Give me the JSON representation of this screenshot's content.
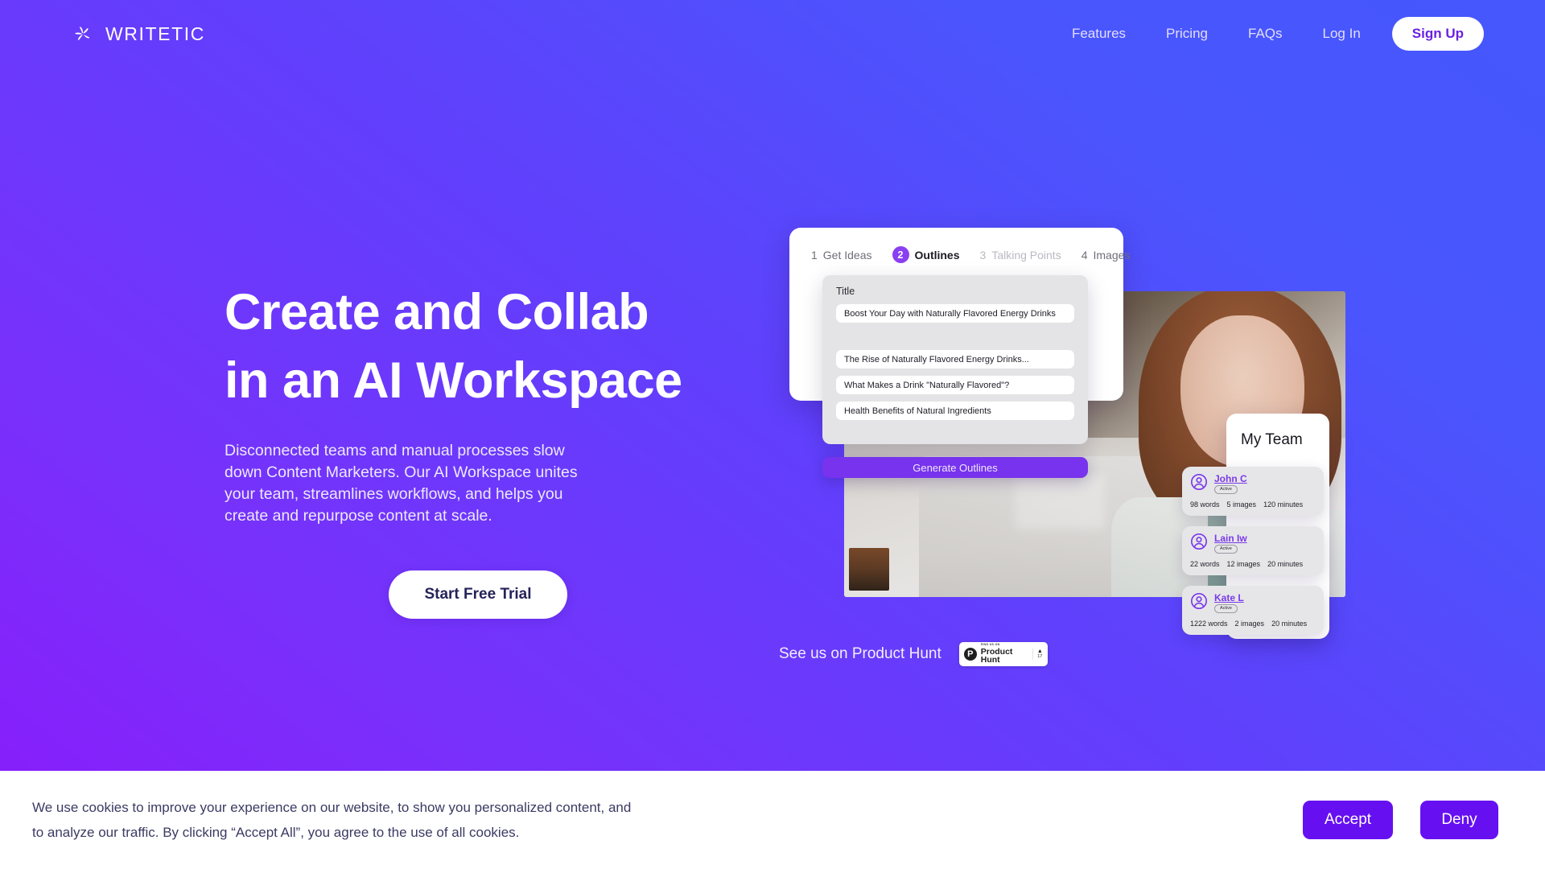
{
  "nav": {
    "brand": "WRITETIC",
    "logo_icon": "pinwheel-star-icon",
    "links": [
      {
        "label": "Features"
      },
      {
        "label": "Pricing"
      },
      {
        "label": "FAQs"
      },
      {
        "label": "Log In"
      }
    ],
    "cta": "Sign Up"
  },
  "hero": {
    "title_line1": "Create and Collab",
    "title_line2": "in an AI Workspace",
    "subtitle": "Disconnected teams and manual processes slow down Content Marketers. Our AI Workspace unites your team, streamlines workflows, and helps you create and repurpose content at scale.",
    "cta": "Start Free Trial"
  },
  "product_hunt": {
    "label": "See us on Product Hunt",
    "badge_kicker": "FIND US ON",
    "badge_name": "Product Hunt",
    "badge_logo": "P",
    "vote_caret": "▲",
    "vote_count": "17"
  },
  "app_mock": {
    "tabs": [
      {
        "num": "1",
        "label": "Get Ideas",
        "state": "muted"
      },
      {
        "num": "2",
        "label": "Outlines",
        "state": "active"
      },
      {
        "num": "3",
        "label": "Talking Points",
        "state": "dim"
      },
      {
        "num": "4",
        "label": "Images",
        "state": "muted"
      }
    ],
    "outline": {
      "label": "Title",
      "title_value": "Boost Your Day with Naturally Flavored Energy Drinks",
      "suggestions": [
        "The Rise of Naturally Flavored Energy Drinks...",
        "What Makes a Drink \"Naturally Flavored\"?",
        "Health Benefits of Natural Ingredients"
      ]
    },
    "generate_button": "Generate Outlines",
    "team": {
      "title": "My Team",
      "members": [
        {
          "name": "John C",
          "status": "Active",
          "words": "98 words",
          "images": "5 images",
          "minutes": "120 minutes"
        },
        {
          "name": "Lain Iw",
          "status": "Active",
          "words": "22 words",
          "images": "12 images",
          "minutes": "20 minutes"
        },
        {
          "name": "Kate L",
          "status": "Active",
          "words": "1222 words",
          "images": "2 images",
          "minutes": "20 minutes"
        }
      ]
    }
  },
  "cookie": {
    "line1": "We use cookies to improve your experience on our website, to show you personalized content, and",
    "line2": "to analyze our traffic. By clicking “Accept All”, you agree to the use of all cookies.",
    "accept": "Accept",
    "deny": "Deny"
  },
  "colors": {
    "gradient_start": "#8a1bfb",
    "gradient_end": "#4557fd",
    "accent_purple": "#7733ed",
    "tab_badge": "#8a3ff0",
    "cookie_button": "#6610f2",
    "member_name": "#7b3ae8"
  }
}
